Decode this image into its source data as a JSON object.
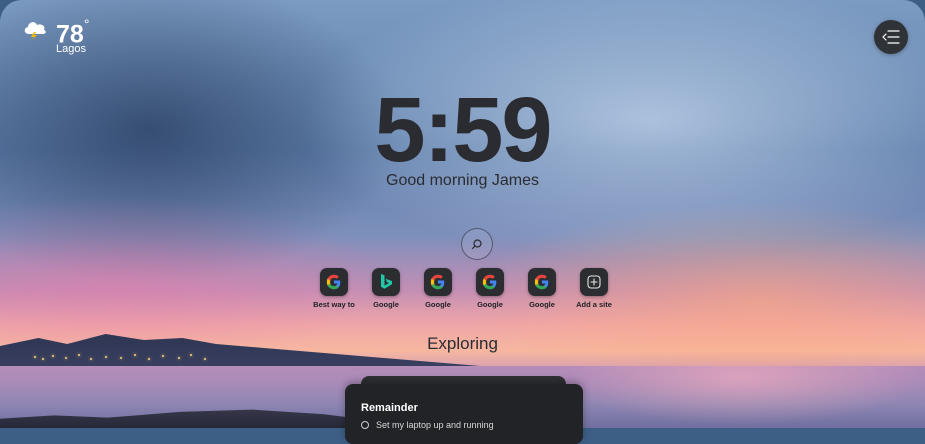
{
  "weather": {
    "icon": "cloud-lightning-icon",
    "temperature": "78",
    "degree_symbol": "°",
    "city": "Lagos"
  },
  "header": {
    "menu_icon": "collapse-menu-icon"
  },
  "clock": {
    "time": "5:59",
    "greeting": "Good morning James"
  },
  "search": {
    "icon": "search-icon"
  },
  "shortcuts": [
    {
      "label": "Best way to",
      "icon": "google-icon"
    },
    {
      "label": "Google",
      "icon": "bing-icon"
    },
    {
      "label": "Google",
      "icon": "google-icon"
    },
    {
      "label": "Google",
      "icon": "google-icon"
    },
    {
      "label": "Google",
      "icon": "google-icon"
    },
    {
      "label": "Add a site",
      "icon": "add-site-icon"
    }
  ],
  "section": {
    "title": "Exploring"
  },
  "reminder": {
    "title": "Remainder",
    "tasks": [
      {
        "text": "Set my laptop up and running",
        "done": false
      }
    ]
  }
}
